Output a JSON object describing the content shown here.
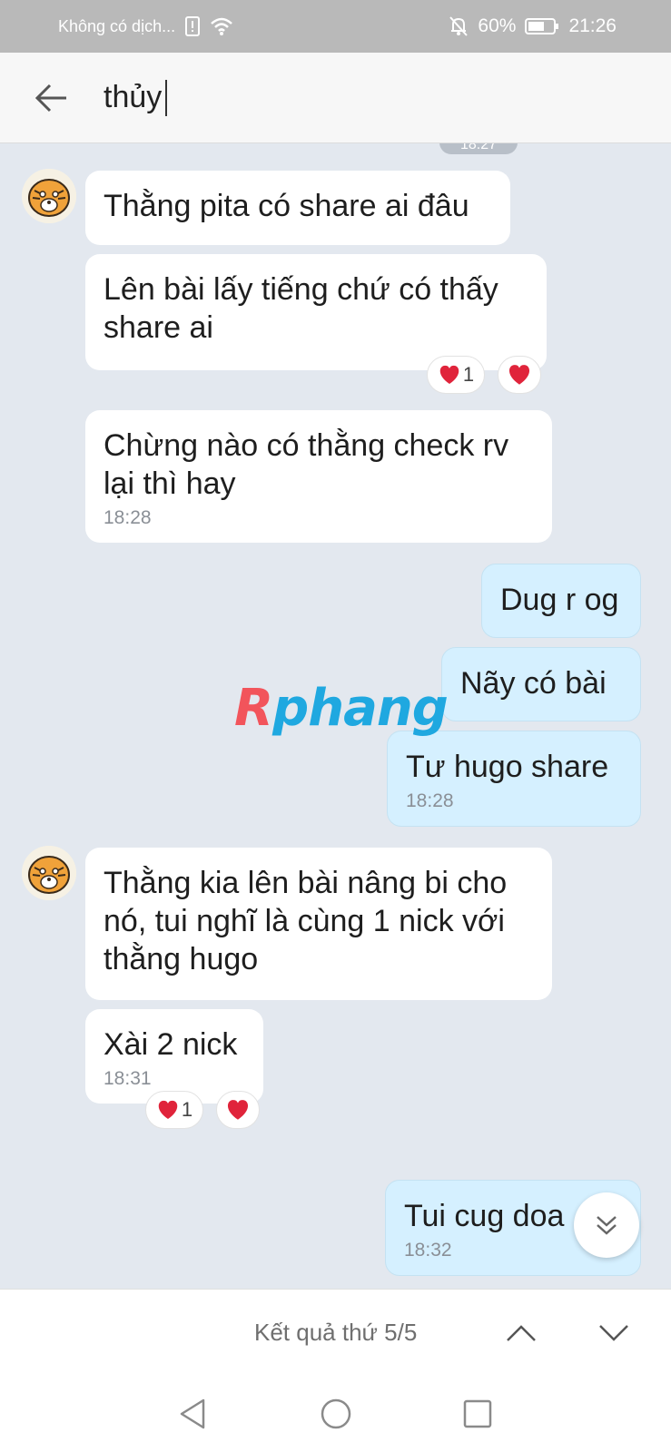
{
  "status_bar": {
    "carrier": "Không có dịch...",
    "battery": "60%",
    "time": "21:26"
  },
  "header": {
    "search_query": "thủy"
  },
  "chat": {
    "peek_time": "18:27",
    "messages": [
      {
        "text": "Thằng pita có share ai đâu"
      },
      {
        "text": "Lên bài lấy tiếng chứ có thấy share ai",
        "reaction_count": "1"
      },
      {
        "text": "Chừng nào có thằng check rv lại thì hay",
        "time": "18:28"
      },
      {
        "text": "Dug r og"
      },
      {
        "text": "Nãy có bài"
      },
      {
        "text": "Tư hugo share",
        "time": "18:28"
      },
      {
        "text": "Thằng kia lên bài nâng bi cho nó, tui nghĩ là cùng 1 nick với thằng hugo"
      },
      {
        "text": "Xài 2 nick",
        "time": "18:31",
        "reaction_count": "1"
      },
      {
        "text": "Tui cug doa",
        "time": "18:32"
      }
    ],
    "watermark": {
      "first": "R",
      "rest": "phang"
    }
  },
  "search_results": {
    "label": "Kết quả thứ 5/5"
  },
  "colors": {
    "chat_bg": "#e3e8ef",
    "incoming_bubble": "#ffffff",
    "outgoing_bubble": "#d5f0ff",
    "heart": "#e0243b"
  },
  "icons": [
    "wifi-icon",
    "bell-off-icon",
    "battery-icon",
    "back-arrow-icon",
    "heart-icon",
    "double-chevron-down-icon",
    "chevron-up-icon",
    "chevron-down-icon",
    "nav-back-icon",
    "nav-home-icon",
    "nav-recents-icon"
  ]
}
